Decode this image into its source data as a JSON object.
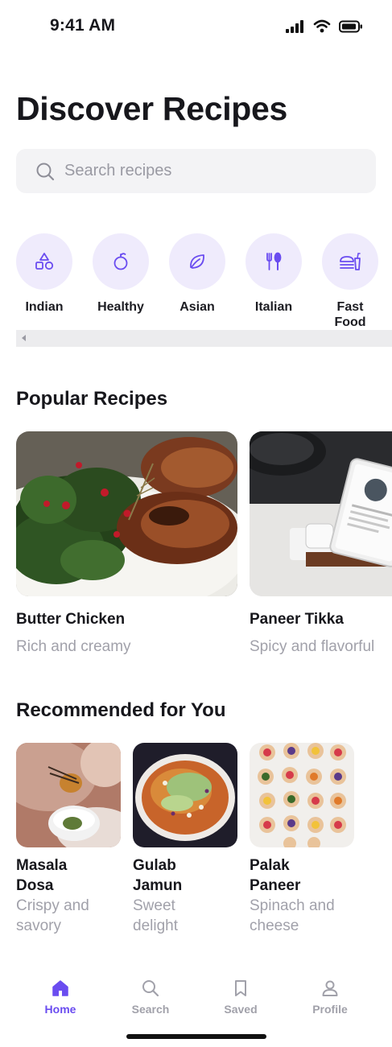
{
  "status_bar": {
    "time": "9:41 AM"
  },
  "page": {
    "title": "Discover Recipes"
  },
  "search": {
    "placeholder": "Search recipes"
  },
  "categories": [
    {
      "label": "Indian",
      "icon": "shapes-icon"
    },
    {
      "label": "Healthy",
      "icon": "apple-icon"
    },
    {
      "label": "Asian",
      "icon": "leaf-icon"
    },
    {
      "label": "Italian",
      "icon": "utensils-icon"
    },
    {
      "label": "Fast Food",
      "icon": "burger-drink-icon"
    }
  ],
  "popular": {
    "title": "Popular Recipes",
    "items": [
      {
        "title": "Butter Chicken",
        "subtitle": "Rich and creamy",
        "image": "grilled chicken with kale and pomegranate"
      },
      {
        "title": "Paneer Tikka",
        "subtitle": "Spicy and flavorful",
        "image": "tablet on kitchen counter"
      }
    ]
  },
  "recommended": {
    "title": "Recommended for You",
    "items": [
      {
        "title": "Masala Dosa",
        "subtitle": "Crispy and savory"
      },
      {
        "title": "Gulab Jamun",
        "subtitle": "Sweet delight"
      },
      {
        "title": "Palak Paneer",
        "subtitle": "Spinach and cheese"
      }
    ]
  },
  "nav": {
    "items": [
      {
        "label": "Home",
        "icon": "home-icon",
        "active": true
      },
      {
        "label": "Search",
        "icon": "search-icon",
        "active": false
      },
      {
        "label": "Saved",
        "icon": "bookmark-icon",
        "active": false
      },
      {
        "label": "Profile",
        "icon": "user-icon",
        "active": false
      }
    ]
  },
  "colors": {
    "accent": "#6a4cf0",
    "category_bg": "#efebfc",
    "muted_text": "#a1a1aa"
  }
}
